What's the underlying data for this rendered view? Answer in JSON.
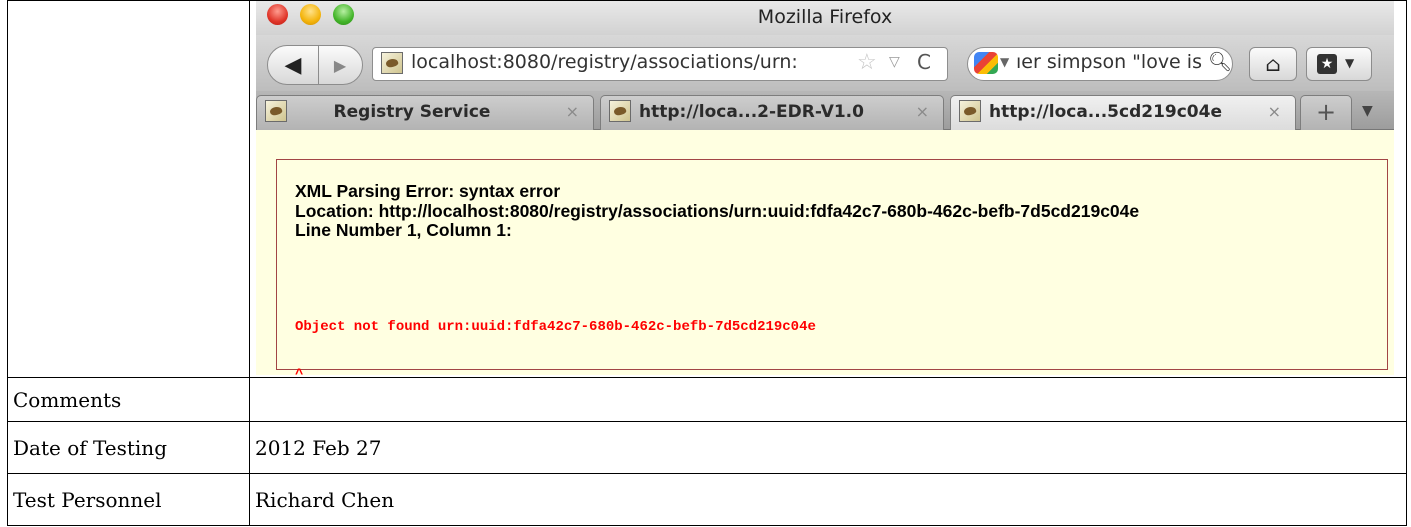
{
  "browser": {
    "window_title": "Mozilla Firefox",
    "url": "localhost:8080/registry/associations/urn:",
    "search_text": "ıer simpson \"love is",
    "tabs": [
      {
        "label": "Registry Service",
        "active": false
      },
      {
        "label": "http://loca...2-EDR-V1.0",
        "active": false
      },
      {
        "label": "http://loca...5cd219c04e",
        "active": true
      }
    ],
    "tab_close_glyph": "×",
    "new_tab_glyph": "+",
    "error": {
      "heading": "XML Parsing Error: syntax error",
      "location": "Location: http://localhost:8080/registry/associations/urn:uuid:fdfa42c7-680b-462c-befb-7d5cd219c04e",
      "line": "Line Number 1, Column 1:",
      "source_line": "Object not found urn:uuid:fdfa42c7-680b-462c-befb-7d5cd219c04e",
      "caret": "^"
    },
    "colors": {
      "error_text": "#ff0000",
      "page_background": "#ffffe1",
      "error_border": "#a24545"
    },
    "icons": [
      "back-arrow-icon",
      "forward-arrow-icon",
      "site-favicon-icon",
      "bookmark-star-icon",
      "reload-icon",
      "google-search-icon",
      "magnifier-icon",
      "home-icon",
      "bookmarks-icon",
      "tab-close-icon",
      "new-tab-icon",
      "tab-list-icon"
    ]
  },
  "table": {
    "rows": [
      {
        "label": "Comments",
        "value": ""
      },
      {
        "label": "Date of Testing",
        "value": "2012 Feb 27"
      },
      {
        "label": "Test Personnel",
        "value": "Richard Chen"
      }
    ]
  }
}
